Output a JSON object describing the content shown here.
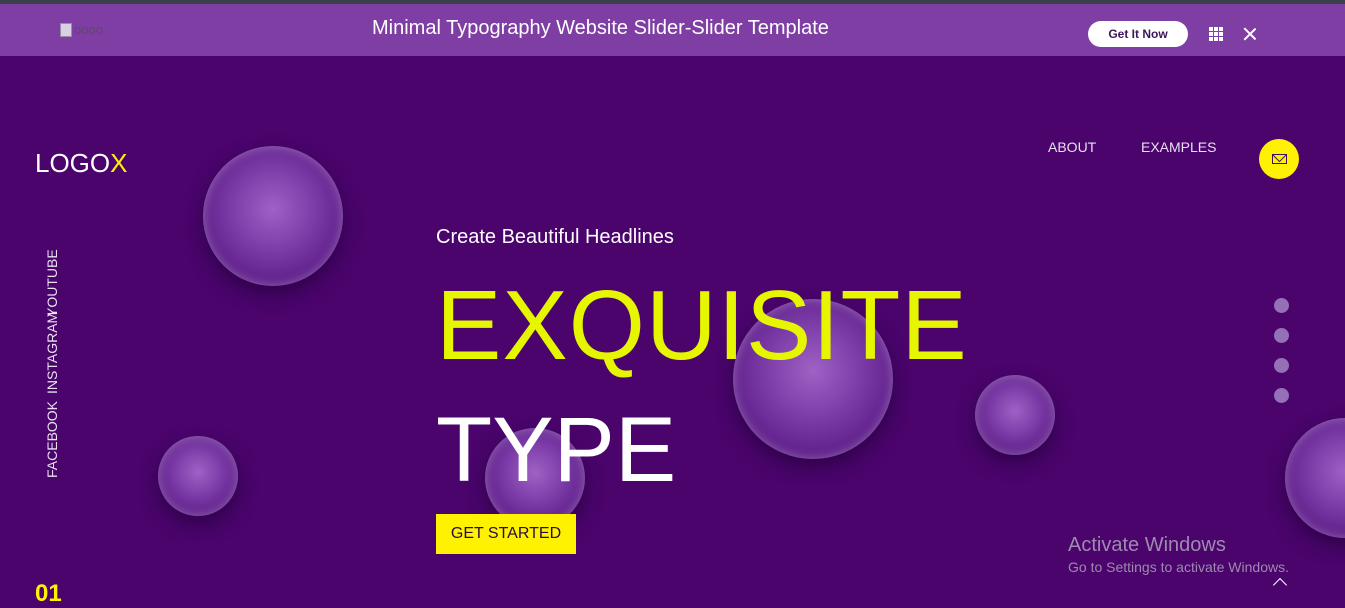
{
  "topbar": {
    "image_alt": "oooo",
    "title": "Minimal Typography Website Slider-Slider Template",
    "get_button": "Get It Now",
    "icons": [
      "grid-icon",
      "close-icon"
    ]
  },
  "site": {
    "logo_text": "LOGO",
    "logo_accent": "X",
    "nav": [
      "ABOUT",
      "EXAMPLES"
    ],
    "contact_icon": "mail-icon",
    "social": [
      "FACEBOOK",
      "INSTAGRAM",
      "YOUTUBE"
    ]
  },
  "hero": {
    "subhead": "Create Beautiful Headlines",
    "headline_line1": "EXQUISITE",
    "headline_line2": "TYPE",
    "cta": "GET STARTED",
    "slide_number": "01",
    "slide_count": 4
  },
  "watermark": {
    "title": "Activate Windows",
    "subtitle": "Go to Settings to activate Windows."
  },
  "colors": {
    "background": "#4a046c",
    "topbar": "#7f3ea3",
    "accent_yellow": "#fff200",
    "headline_yellow": "#e6f500"
  }
}
